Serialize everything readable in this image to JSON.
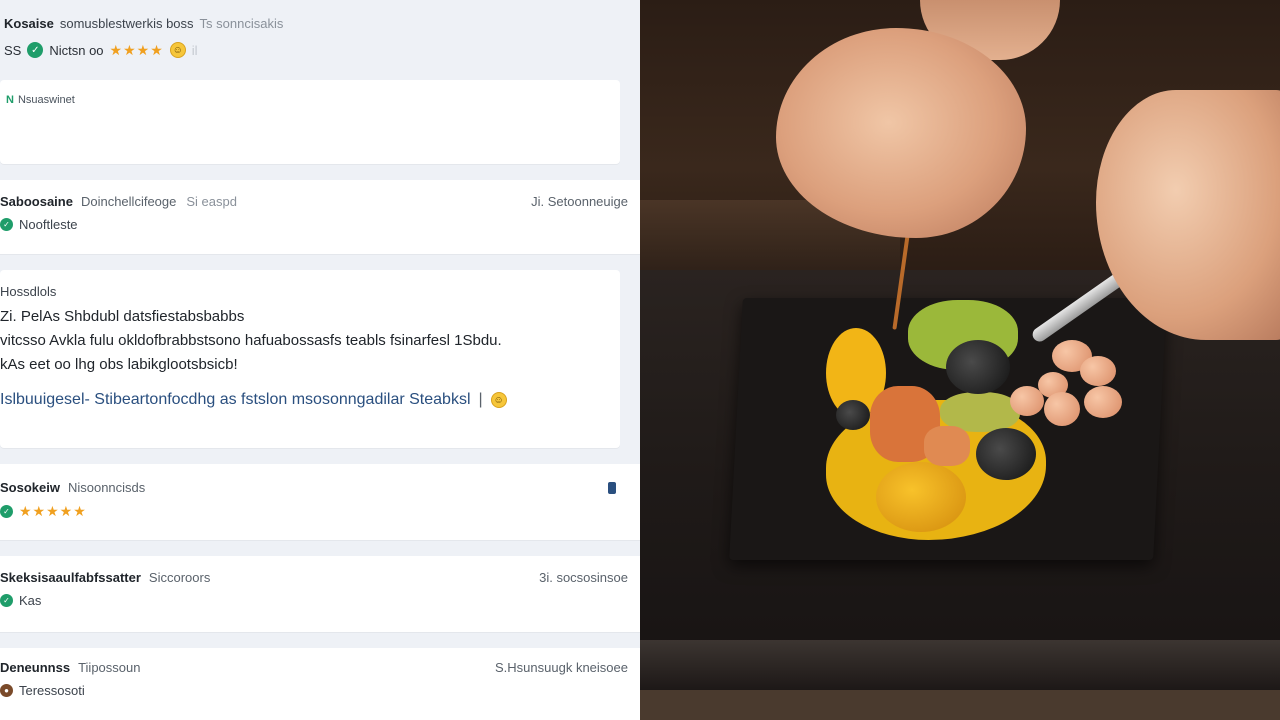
{
  "header": {
    "title_bold": "Kosaise",
    "title_rest": "somusblestwerkis boss",
    "title_muted": "Ts sonncisakis",
    "meta_prefix": "SS",
    "meta_text": "Nictsn oo",
    "meta_ghost": "il"
  },
  "reply_box": {
    "badge": "N",
    "text": "Nsuaswinet"
  },
  "reviews": [
    {
      "name": "Saboosaine",
      "subtitle": "Doinchellcifeoge",
      "faint": "Si easpd",
      "right_meta": "Ji. Setoonneuige",
      "line2": "Nooftleste"
    },
    {
      "label": "Hossdlols",
      "lines": [
        "Zi. PelAs Shbdubl datsfiestabsbabbs",
        "vitcsso Avkla fulu okldofbrabbstsono hafuabossasfs teabls fsinarfesl 1Sbdu.",
        "kAs eet oo lhg obs labikglootsbsicb!"
      ],
      "highlight": "Islbuuigesel- Stibeartonfocdhg as fstslon msosonngadilar Steabksl"
    },
    {
      "name": "Sosokeiw",
      "subtitle": "Nisoonncisds"
    },
    {
      "name": "Skeksisaaulfabfssatter",
      "subtitle": "Siccoroors",
      "right_meta": "3i. socsosinsoe",
      "line2": "Kas"
    },
    {
      "name": "Deneunnss",
      "subtitle": "Tiipossoun",
      "right_meta": "S.Hsunsuugk kneisoee",
      "line2": "Teressosoti"
    }
  ],
  "colors": {
    "accent_green": "#1f9d6a",
    "star": "#f0a020",
    "link_blue": "#2a4f7f",
    "panel_bg": "#eef1f6"
  }
}
